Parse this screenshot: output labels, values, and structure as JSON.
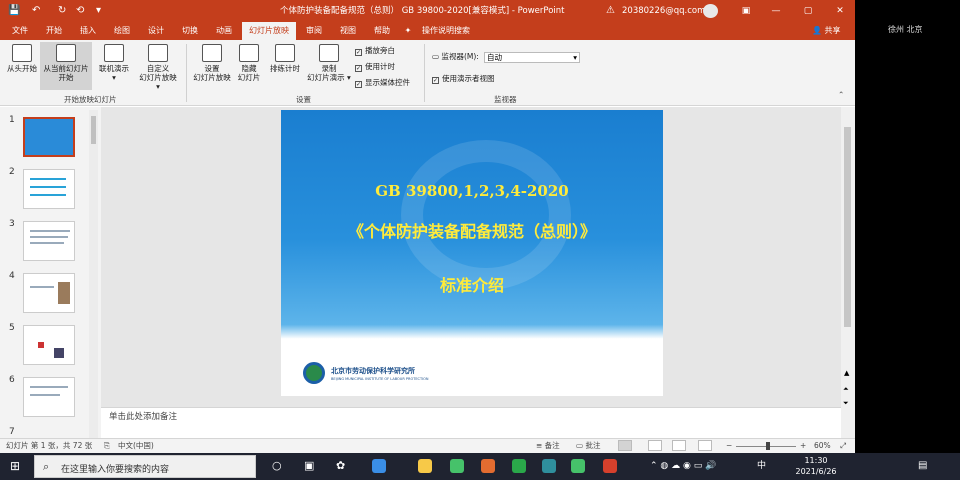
{
  "window": {
    "title": "个体防护装备配备规范（总则） GB 39800-2020[兼容模式] - PowerPoint",
    "account": "20380226@qq.com",
    "warn_icon": "warning-icon",
    "controls": {
      "minimize": "—",
      "maximize": "▢",
      "close": "✕"
    }
  },
  "quick_access": {
    "save": "💾",
    "undo": "↶",
    "redo": "↻",
    "repeat": "⟲",
    "customize": "▾"
  },
  "menu": {
    "tabs": [
      "文件",
      "开始",
      "插入",
      "绘图",
      "设计",
      "切换",
      "动画",
      "幻灯片放映",
      "审阅",
      "视图",
      "帮助"
    ],
    "active_tab": "幻灯片放映",
    "tell_me": "操作说明搜索",
    "share": "共享"
  },
  "ribbon": {
    "buttons": {
      "from_beginning": "从头开始",
      "from_current_1": "从当前幻灯片",
      "from_current_2": "开始",
      "online_1": "联机演示",
      "online_2": "▾",
      "custom_1": "自定义",
      "custom_2": "幻灯片放映 ▾",
      "setup_1": "设置",
      "setup_2": "幻灯片放映",
      "hide_1": "隐藏",
      "hide_2": "幻灯片",
      "rehearse": "排练计时",
      "record_1": "录制",
      "record_2": "幻灯片演示 ▾"
    },
    "checks": {
      "play_narrations": "播放旁白",
      "use_timings": "使用计时",
      "show_media_controls": "显示媒体控件",
      "use_presenter_view": "使用演示者视图"
    },
    "monitor_label": "监视器(M):",
    "monitor_value": "自动",
    "groups": {
      "start": "开始放映幻灯片",
      "setup": "设置",
      "monitors": "监视器"
    }
  },
  "thumbnails": [
    "1",
    "2",
    "3",
    "4",
    "5",
    "6",
    "7"
  ],
  "slide": {
    "line1": "GB 39800,1,2,3,4-2020",
    "line2": "《个体防护装备配备规范（总则）》",
    "line3": "标准介绍",
    "org_name": "北京市劳动保护科学研究所",
    "org_name_en": "BEIJING MUNICIPAL INSTITUTE OF LABOUR PROTECTION"
  },
  "notes_placeholder": "单击此处添加备注",
  "status": {
    "slide_info": "幻灯片 第 1 张，共 72 张",
    "language": "中文(中国)",
    "notes": "备注",
    "comments": "批注",
    "zoom": "60%",
    "zoom_fraction": 0.6
  },
  "side": {
    "location": "徐州 北京"
  },
  "taskbar": {
    "search_placeholder": "在这里输入你要搜索的内容",
    "time": "11:30",
    "date": "2021/6/26",
    "ime": "中",
    "colors": [
      "#f7c948",
      "#e36c30",
      "#2aa84a",
      "#3a8ee6",
      "#2f8f9d",
      "#c43e1c",
      "#46c26a",
      "#d6402c"
    ]
  }
}
